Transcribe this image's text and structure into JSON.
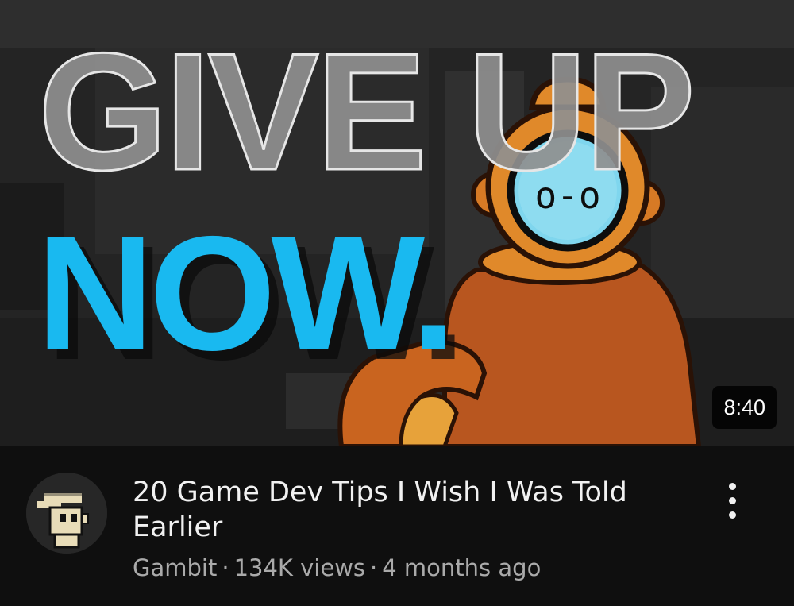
{
  "thumbnail": {
    "headline_top": "GIVE UP",
    "headline_bottom": "NOW.",
    "character_face": "o-o",
    "duration": "8:40",
    "colors": {
      "headline_top": "#8f8f8f",
      "headline_bottom": "#19b9f0",
      "suit": "#b8561f",
      "helmet": "#e0892a",
      "visor": "#7fd6ee"
    }
  },
  "video": {
    "title": "20 Game Dev Tips I Wish I Was Told Earlier",
    "channel": "Gambit",
    "separator": "·",
    "views": "134K views",
    "age": "4 months ago"
  },
  "icons": {
    "more": "more-vert-icon",
    "avatar": "pixel-art-avatar"
  }
}
